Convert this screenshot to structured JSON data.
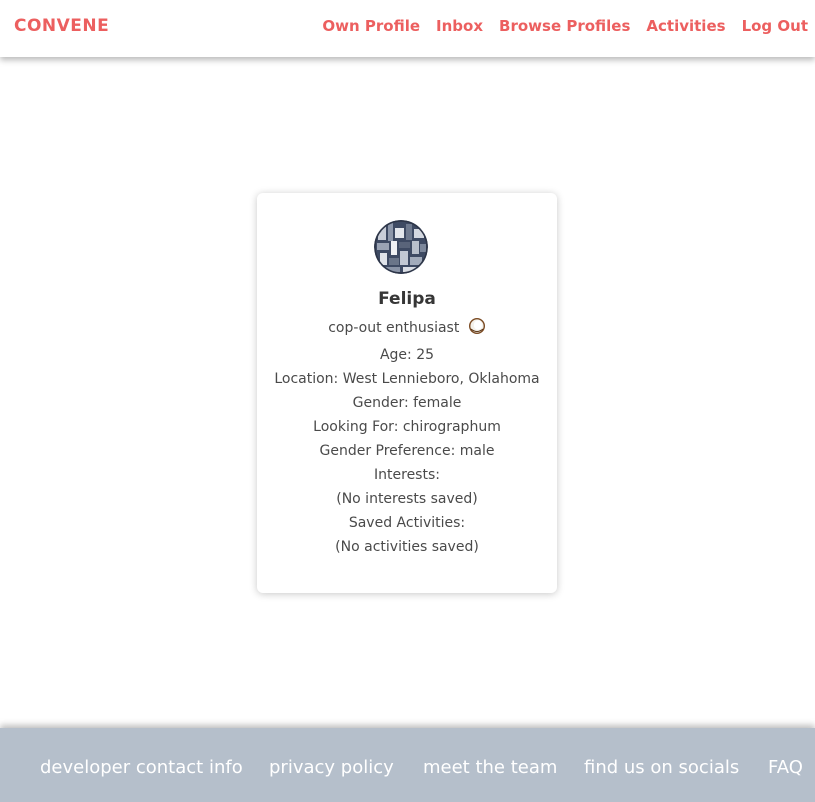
{
  "nav": {
    "brand": "CONVENE",
    "links": [
      "Own Profile",
      "Inbox",
      "Browse Profiles",
      "Activities",
      "Log Out"
    ]
  },
  "profile": {
    "name": "Felipa",
    "tagline": "cop-out enthusiast",
    "tagline_icon": "coconut-icon",
    "age": "Age: 25",
    "location": "Location: West Lennieboro, Oklahoma",
    "gender": "Gender: female",
    "looking_for": "Looking For: chirographum",
    "gender_preference": "Gender Preference: male",
    "interests_label": "Interests:",
    "interests_value": "(No interests saved)",
    "activities_label": "Saved Activities:",
    "activities_value": "(No activities saved)"
  },
  "footer": {
    "links": [
      "developer contact info",
      "privacy policy",
      "meet the team",
      "find us on socials",
      "FAQ"
    ]
  },
  "colors": {
    "accent": "#ec5f5f",
    "footer_bg": "#b5bfcb"
  }
}
